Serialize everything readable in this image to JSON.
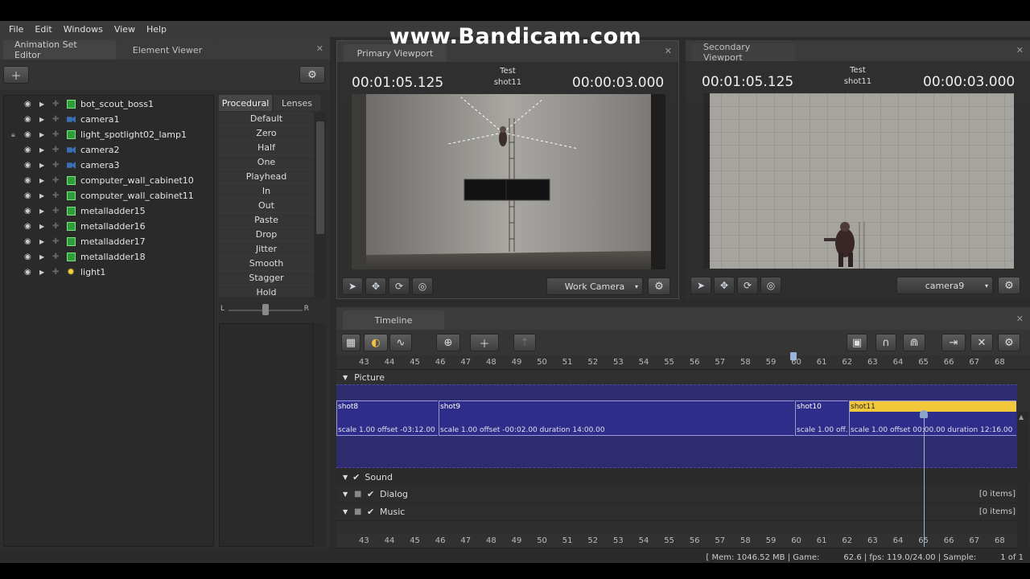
{
  "menu": [
    "File",
    "Edit",
    "Windows",
    "View",
    "Help"
  ],
  "watermark": "www.Bandicam.com",
  "left_tabs": {
    "active": "Animation Set Editor",
    "inactive": "Element Viewer"
  },
  "tree": [
    {
      "label": "bot_scout_boss1",
      "icon": "cube",
      "locked": false
    },
    {
      "label": "camera1",
      "icon": "camera",
      "locked": false
    },
    {
      "label": "light_spotlight02_lamp1",
      "icon": "cube",
      "locked": true
    },
    {
      "label": "camera2",
      "icon": "camera",
      "locked": false
    },
    {
      "label": "camera3",
      "icon": "camera",
      "locked": false
    },
    {
      "label": "computer_wall_cabinet10",
      "icon": "cube",
      "locked": false
    },
    {
      "label": "computer_wall_cabinet11",
      "icon": "cube",
      "locked": false
    },
    {
      "label": "metalladder15",
      "icon": "cube",
      "locked": false
    },
    {
      "label": "metalladder16",
      "icon": "cube",
      "locked": false
    },
    {
      "label": "metalladder17",
      "icon": "cube",
      "locked": false
    },
    {
      "label": "metalladder18",
      "icon": "cube",
      "locked": false
    },
    {
      "label": "light1",
      "icon": "sun",
      "locked": false
    }
  ],
  "proc_tabs": {
    "active": "Procedural",
    "inactive": "Lenses"
  },
  "procedural": [
    "Default",
    "Zero",
    "Half",
    "One",
    "Playhead",
    "In",
    "Out",
    "Paste",
    "Drop",
    "Jitter",
    "Smooth",
    "Stagger",
    "Hold"
  ],
  "slider": {
    "left": "L",
    "right": "R",
    "value": 0.5
  },
  "primary": {
    "tab": "Primary Viewport",
    "time_left": "00:01:05.125",
    "title": "Test",
    "shot": "shot11",
    "time_right": "00:00:03.000",
    "camera": "Work Camera"
  },
  "secondary": {
    "tab": "Secondary Viewport",
    "time_left": "00:01:05.125",
    "title": "Test",
    "shot": "shot11",
    "time_right": "00:00:03.000",
    "camera": "camera9"
  },
  "timeline": {
    "tab": "Timeline",
    "ticks": [
      "43",
      "44",
      "45",
      "46",
      "47",
      "48",
      "49",
      "50",
      "51",
      "52",
      "53",
      "54",
      "55",
      "56",
      "57",
      "58",
      "59",
      "60",
      "61",
      "62",
      "63",
      "64",
      "65",
      "66",
      "67",
      "68"
    ],
    "picture_label": "Picture",
    "clips": [
      {
        "name": "shot8",
        "info": "scale 1.00 offset -03:12.00 d..."
      },
      {
        "name": "shot9",
        "info": "scale 1.00 offset -00:02.00 duration  14:00.00"
      },
      {
        "name": "shot10",
        "info": "scale 1.00 off..."
      },
      {
        "name": "shot11",
        "info": "scale 1.00 offset  00:00.00 duration  12:16.00"
      }
    ],
    "sound_label": "Sound",
    "tracks": [
      {
        "name": "Dialog",
        "items": "[0 items]"
      },
      {
        "name": "Music",
        "items": "[0 items]"
      }
    ]
  },
  "status": {
    "mem": "[ Mem:  1046.52 MB | Game:",
    "game": "62.6 | fps:  119.0/24.00 | Sample:",
    "page": "1 of 1"
  }
}
